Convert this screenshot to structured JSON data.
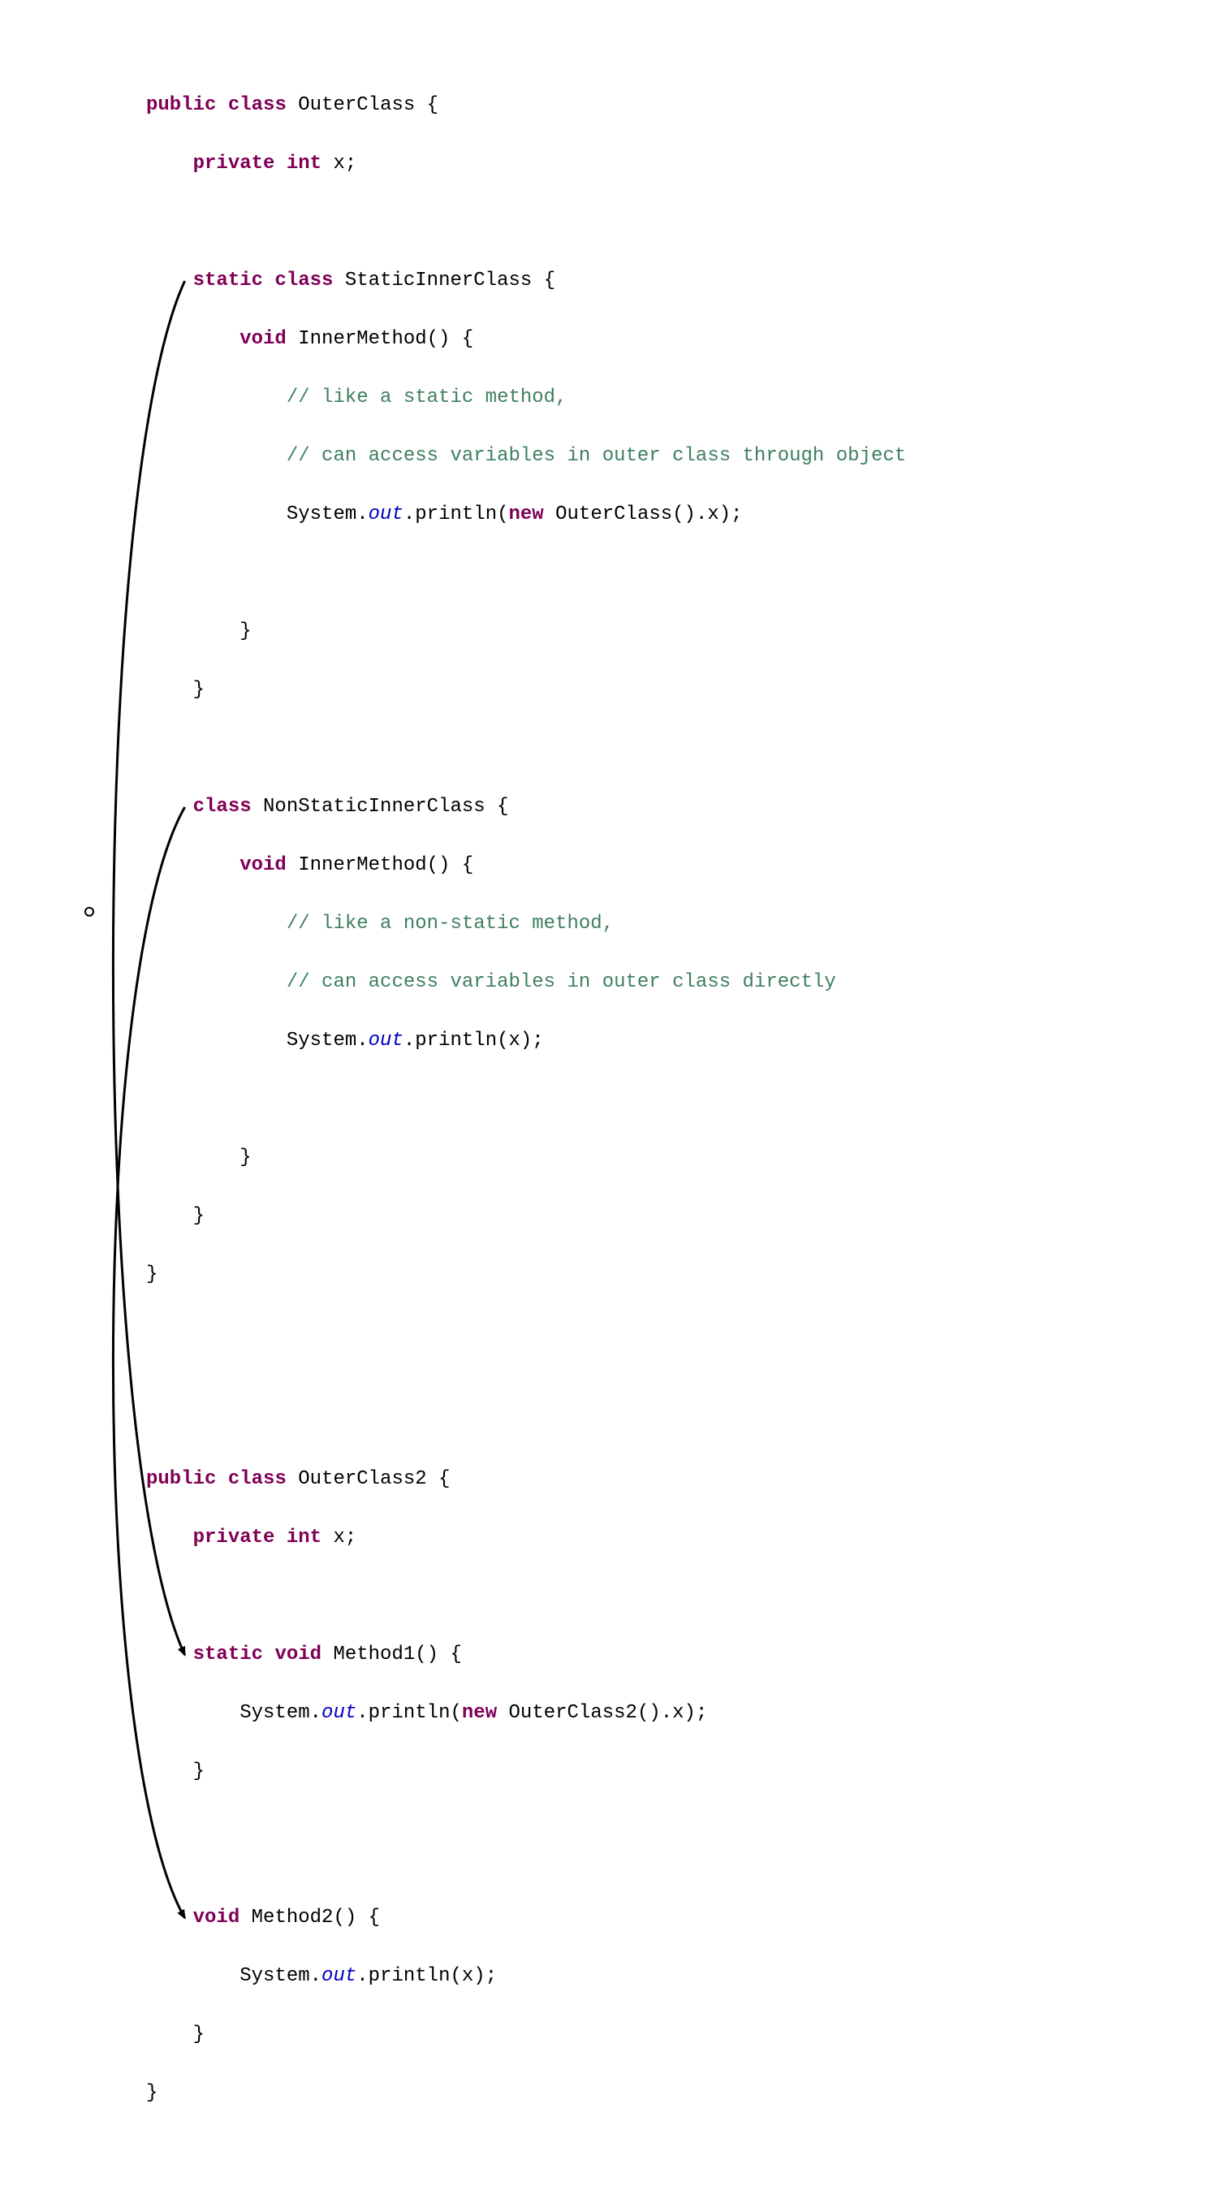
{
  "colors": {
    "keyword": "#7f0055",
    "comment": "#3f7f5f",
    "staticField": "#0000c0",
    "text": "#000000",
    "arrow": "#000000"
  },
  "arrows": [
    {
      "from": "static-inner-class",
      "to": "method1"
    },
    {
      "from": "non-static-inner-class",
      "to": "method2"
    }
  ],
  "code": {
    "block1": {
      "l1_kw1": "public",
      "l1_kw2": "class",
      "l1_nm": " OuterClass {",
      "l2_kw1": "private",
      "l2_kw2": "int",
      "l2_nm": " x;",
      "l3_kw1": "static",
      "l3_kw2": "class",
      "l3_nm": " StaticInnerClass {",
      "l4_kw": "void",
      "l4_nm": " InnerMethod() {",
      "l5_cm": "// like a static method,",
      "l6_cm": "// can access variables in outer class through object",
      "l7_a": "System.",
      "l7_it": "out",
      "l7_b": ".println(",
      "l7_kw": "new",
      "l7_c": " OuterClass().x);",
      "l8_nm": "}",
      "l9_nm": "}",
      "l10_kw": "class",
      "l10_nm": " NonStaticInnerClass {",
      "l11_kw": "void",
      "l11_nm": " InnerMethod() {",
      "l12_cm": "// like a non-static method,",
      "l13_cm": "// can access variables in outer class directly",
      "l14_a": "System.",
      "l14_it": "out",
      "l14_b": ".println(x);",
      "l15_nm": "}",
      "l16_nm": "}",
      "l17_nm": "}"
    },
    "block2": {
      "l1_kw1": "public",
      "l1_kw2": "class",
      "l1_nm": " OuterClass2 {",
      "l2_kw1": "private",
      "l2_kw2": "int",
      "l2_nm": " x;",
      "l3_kw1": "static",
      "l3_kw2": "void",
      "l3_nm": " Method1() {",
      "l4_a": "System.",
      "l4_it": "out",
      "l4_b": ".println(",
      "l4_kw": "new",
      "l4_c": " OuterClass2().x);",
      "l5_nm": "}",
      "l6_kw": "void",
      "l6_nm": " Method2() {",
      "l7_a": "System.",
      "l7_it": "out",
      "l7_b": ".println(x);",
      "l8_nm": "}",
      "l9_nm": "}"
    }
  }
}
